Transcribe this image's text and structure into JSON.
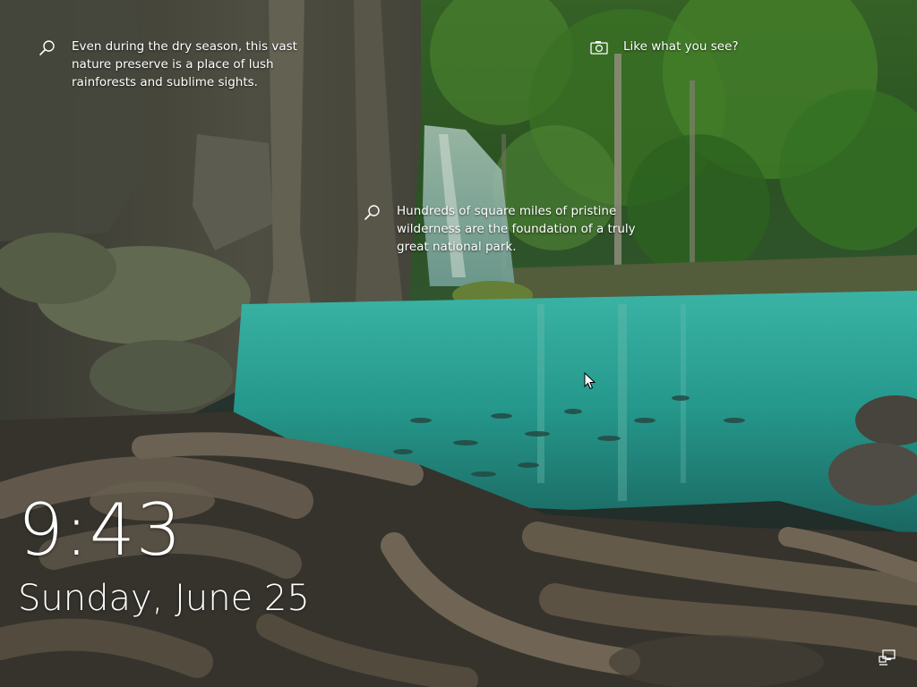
{
  "lockscreen": {
    "spotlight": {
      "left_tip": "Even during the dry season, this vast nature preserve is a place of lush rainforests and sublime sights.",
      "right_tip": "Like what you see?",
      "middle_tip": "Hundreds of square miles of pristine wilderness are the foundation of a truly great national park."
    },
    "time": "9:43",
    "date": "Sunday, June 25",
    "icons": {
      "left_tip_icon": "search-icon",
      "right_tip_icon": "camera-icon",
      "middle_tip_icon": "search-icon",
      "status_icon": "network-icon"
    }
  },
  "colors": {
    "foliage": "#3f7d2c",
    "water": "#2fb3a4",
    "rock": "#5a5a50",
    "text": "#ffffff"
  }
}
